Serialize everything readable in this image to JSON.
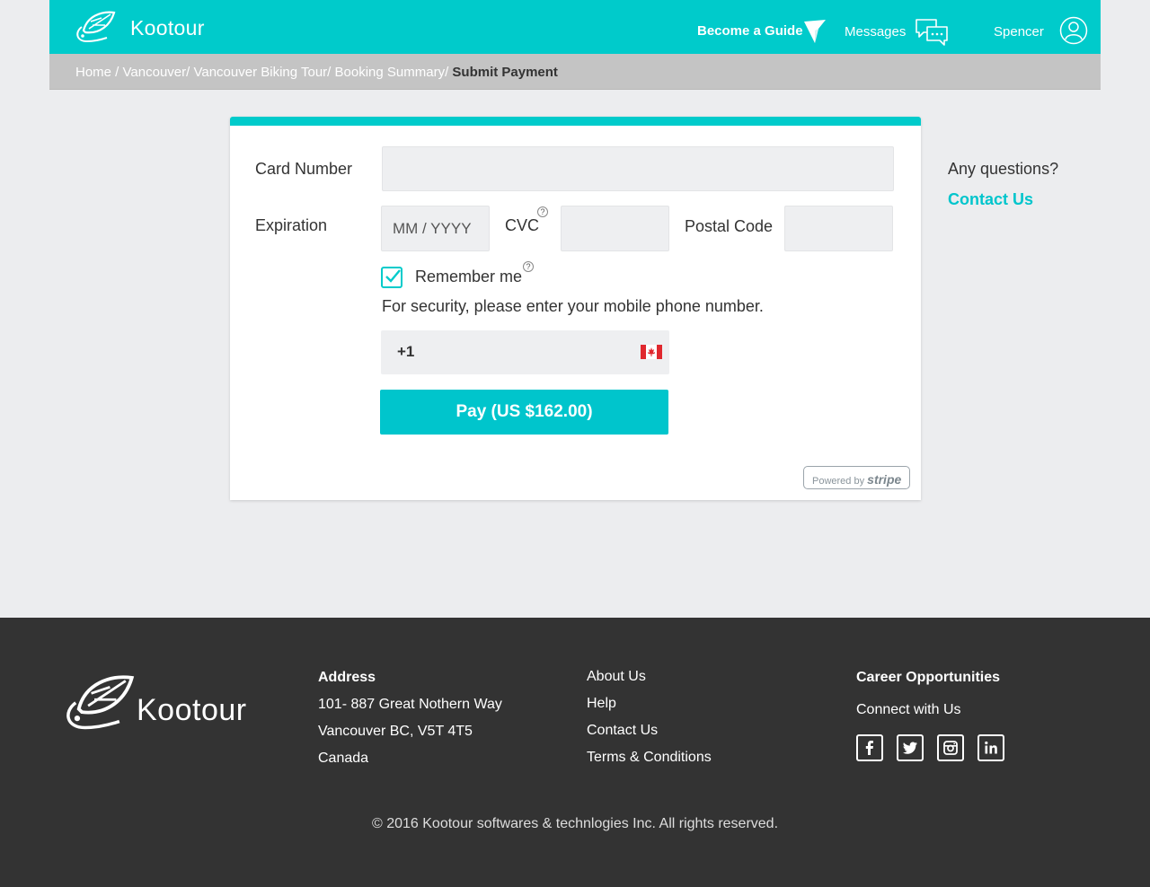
{
  "header": {
    "brand": "Kootour",
    "become_guide": "Become a Guide",
    "messages": "Messages",
    "user_name": "Spencer"
  },
  "breadcrumb": {
    "items": [
      "Home /",
      "Vancouver/",
      "Vancouver Biking Tour/",
      "Booking Summary/"
    ],
    "current": "Submit Payment"
  },
  "payment_form": {
    "card_number_label": "Card Number",
    "card_number_value": "",
    "expiration_label": "Expiration",
    "expiration_placeholder": "MM / YYYY",
    "cvc_label": "CVC",
    "cvc_help": "?",
    "cvc_value": "",
    "postal_code_label": "Postal Code",
    "postal_code_value": "",
    "remember_me_label": "Remember me",
    "remember_me_help": "?",
    "remember_me_checked": true,
    "security_note": "For security, please enter your mobile phone number.",
    "phone_prefix": "+1",
    "phone_country": "Canada flag",
    "pay_button": "Pay (US $162.00)",
    "powered_by": "Powered by",
    "powered_by_brand": "stripe"
  },
  "sidebar": {
    "question": "Any questions?",
    "contact_link": "Contact Us"
  },
  "footer": {
    "brand": "Kootour",
    "address_head": "Address",
    "address_line1": "101- 887 Great Nothern Way",
    "address_line2": "Vancouver BC,  V5T 4T5",
    "address_line3": "Canada",
    "links": [
      "About Us",
      "Help",
      "Contact Us",
      "Terms & Conditions"
    ],
    "career": "Career Opportunities",
    "connect": "Connect with Us",
    "social_icons": [
      "facebook-icon",
      "twitter-icon",
      "instagram-icon",
      "linkedin-icon"
    ],
    "copyright": "© 2016 Kootour softwares & technlogies Inc. All rights reserved."
  },
  "colors": {
    "accent": "#00cbcb",
    "breadcrumb_bg": "#c4c4c4",
    "footer_bg": "#333333",
    "page_bg": "#ecedef"
  }
}
